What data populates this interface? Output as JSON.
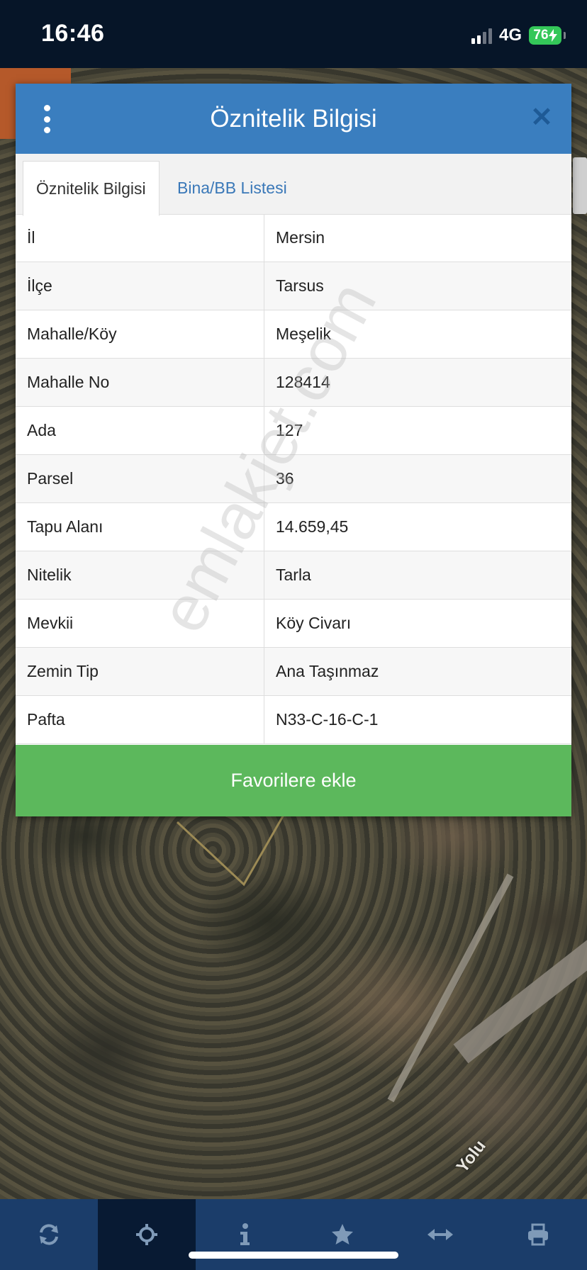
{
  "status_bar": {
    "time": "16:46",
    "network": "4G",
    "battery": "76"
  },
  "map": {
    "road_label": "Yolu",
    "watermark": "emlakjet.com"
  },
  "dialog": {
    "title": "Öznitelik Bilgisi",
    "tabs": [
      {
        "label": "Öznitelik Bilgisi",
        "active": true
      },
      {
        "label": "Bina/BB Listesi",
        "active": false
      }
    ],
    "rows": [
      {
        "key": "İl",
        "value": "Mersin"
      },
      {
        "key": "İlçe",
        "value": "Tarsus"
      },
      {
        "key": "Mahalle/Köy",
        "value": "Meşelik"
      },
      {
        "key": "Mahalle No",
        "value": "128414"
      },
      {
        "key": "Ada",
        "value": "127"
      },
      {
        "key": "Parsel",
        "value": "36"
      },
      {
        "key": "Tapu Alanı",
        "value": "14.659,45"
      },
      {
        "key": "Nitelik",
        "value": "Tarla"
      },
      {
        "key": "Mevkii",
        "value": "Köy Civarı"
      },
      {
        "key": "Zemin Tip",
        "value": "Ana Taşınmaz"
      },
      {
        "key": "Pafta",
        "value": "N33-C-16-C-1"
      }
    ],
    "favorite_button": "Favorilere ekle"
  },
  "toolbar": {
    "items": [
      {
        "icon": "refresh-icon"
      },
      {
        "icon": "locate-icon",
        "active": true
      },
      {
        "icon": "info-icon"
      },
      {
        "icon": "star-icon"
      },
      {
        "icon": "measure-icon"
      },
      {
        "icon": "print-icon"
      }
    ]
  },
  "colors": {
    "header": "#3a7ebf",
    "favorite": "#5cb85c",
    "toolbar": "#1b3d6a",
    "status_bar": "#061528"
  }
}
